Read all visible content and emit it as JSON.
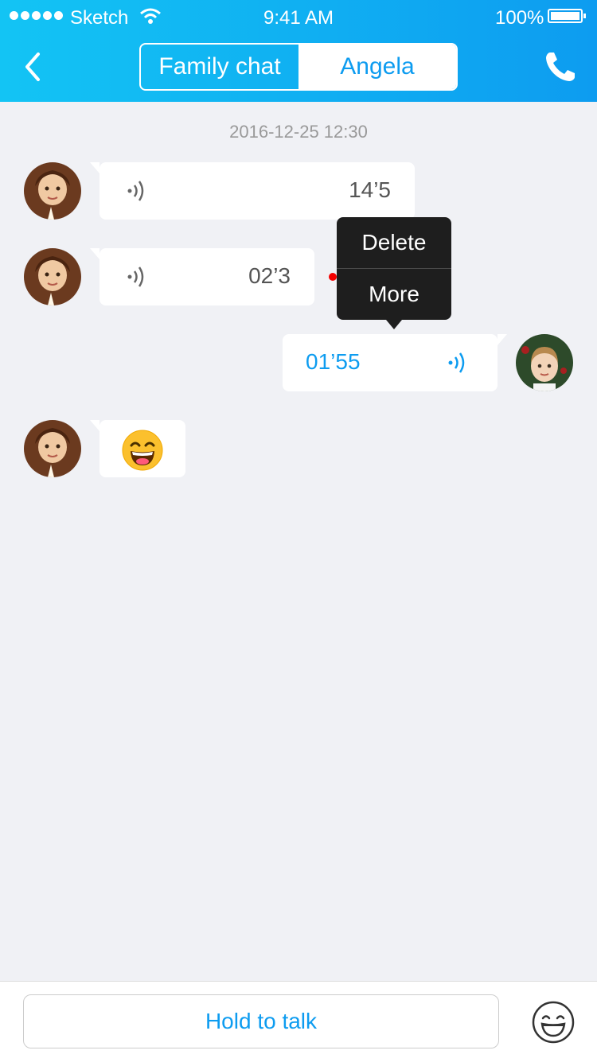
{
  "status_bar": {
    "carrier": "Sketch",
    "time": "9:41 AM",
    "battery": "100%"
  },
  "header": {
    "back_icon": "chevron-left-icon",
    "call_icon": "phone-icon",
    "tabs": [
      {
        "label": "Family chat",
        "active": true
      },
      {
        "label": "Angela",
        "active": false
      }
    ],
    "colors": {
      "gradient_start": "#13c4f4",
      "gradient_end": "#0d9cf0"
    }
  },
  "chat": {
    "timestamp": "2016-12-25 12:30",
    "messages": [
      {
        "from": "girl",
        "type": "voice",
        "duration": "14’5"
      },
      {
        "from": "girl",
        "type": "voice",
        "duration": "02’3",
        "unread": true
      },
      {
        "from": "boy",
        "type": "voice",
        "duration": "01’55"
      },
      {
        "from": "girl",
        "type": "emoji",
        "emoji": "grinning-face-icon"
      }
    ]
  },
  "context_menu": {
    "items": [
      "Delete",
      "More"
    ]
  },
  "footer": {
    "hold_to_talk": "Hold to talk",
    "emoji_icon": "smiley-icon"
  }
}
